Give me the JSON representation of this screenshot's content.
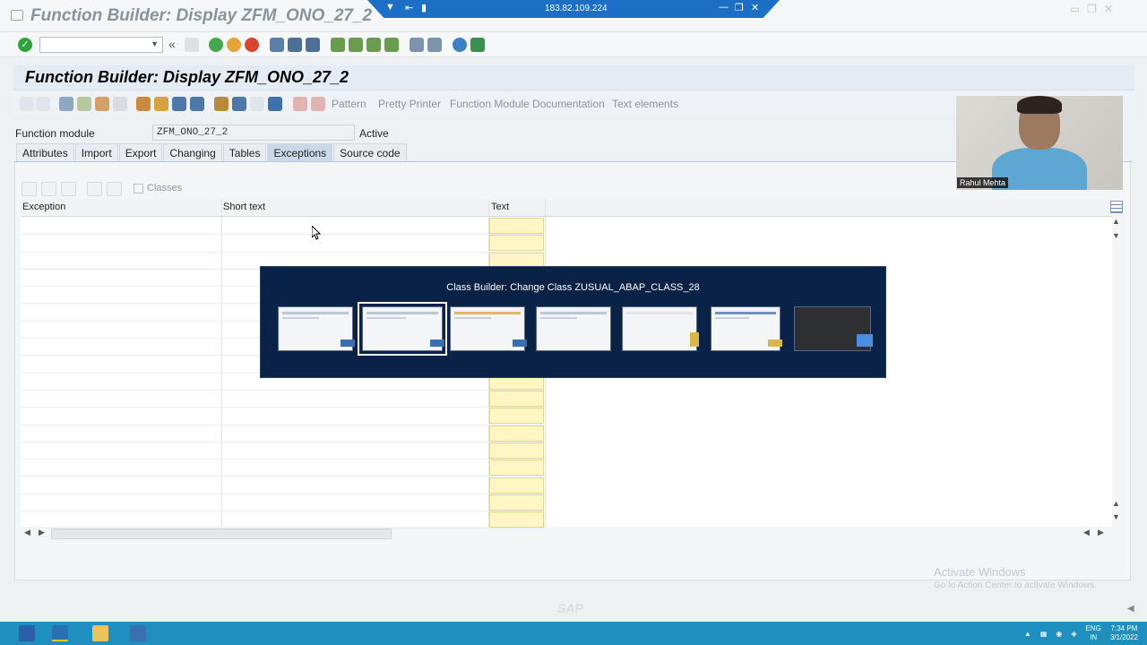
{
  "window": {
    "title": "Function Builder: Display ZFM_ONO_27_2",
    "rdp_ip": "183.82.109.224"
  },
  "screen": {
    "title": "Function Builder: Display ZFM_ONO_27_2"
  },
  "app_toolbar": {
    "pattern": "Pattern",
    "pretty_printer": "Pretty Printer",
    "fm_documentation": "Function Module Documentation",
    "text_elements": "Text elements"
  },
  "function_module": {
    "label": "Function module",
    "value": "ZFM_ONO_27_2",
    "status": "Active"
  },
  "tabs": [
    {
      "label": "Attributes"
    },
    {
      "label": "Import"
    },
    {
      "label": "Export"
    },
    {
      "label": "Changing"
    },
    {
      "label": "Tables"
    },
    {
      "label": "Exceptions"
    },
    {
      "label": "Source code"
    }
  ],
  "active_tab": "Exceptions",
  "table_toolbar": {
    "classes_label": "Classes"
  },
  "grid": {
    "columns": [
      "Exception",
      "Short text",
      "Text"
    ],
    "rows": []
  },
  "alt_tab": {
    "window_title": "Class Builder: Change Class ZUSUAL_ABAP_CLASS_28"
  },
  "webcam": {
    "name": "Rahul Mehta"
  },
  "watermark": {
    "line1": "Activate Windows",
    "line2": "Go to Action Center to activate Windows.",
    "sap": "SAP"
  },
  "taskbar": {
    "lang_top": "ENG",
    "lang_bottom": "IN",
    "time": "7:34 PM",
    "date": "3/1/2022"
  }
}
